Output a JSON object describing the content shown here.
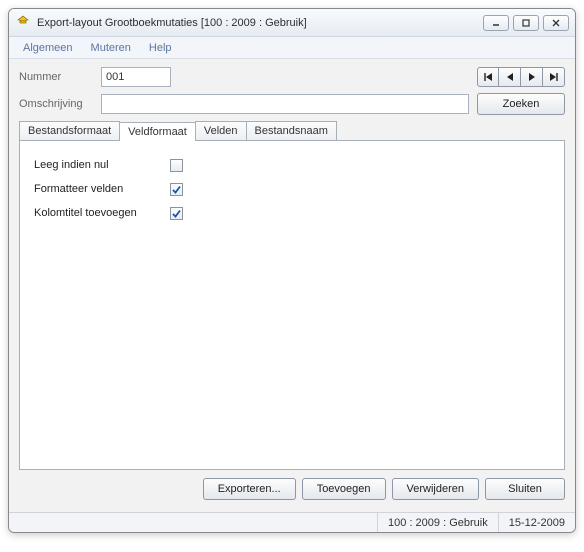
{
  "window": {
    "title": "Export-layout Grootboekmutaties  [100 : 2009 : Gebruik]"
  },
  "menu": {
    "algemeen": "Algemeen",
    "muteren": "Muteren",
    "help": "Help"
  },
  "form": {
    "nummer_label": "Nummer",
    "nummer_value": "001",
    "omschrijving_label": "Omschrijving",
    "omschrijving_value": "",
    "zoeken": "Zoeken"
  },
  "tabs": {
    "bestandsformaat": "Bestandsformaat",
    "veldformaat": "Veldformaat",
    "velden": "Velden",
    "bestandsnaam": "Bestandsnaam"
  },
  "veldformaat": {
    "leeg_label": "Leeg indien nul",
    "leeg_checked": false,
    "formatteer_label": "Formatteer velden",
    "formatteer_checked": true,
    "kolomtitel_label": "Kolomtitel toevoegen",
    "kolomtitel_checked": true
  },
  "buttons": {
    "exporteren": "Exporteren...",
    "toevoegen": "Toevoegen",
    "verwijderen": "Verwijderen",
    "sluiten": "Sluiten"
  },
  "status": {
    "context": "100 : 2009 : Gebruik",
    "date": "15-12-2009"
  }
}
